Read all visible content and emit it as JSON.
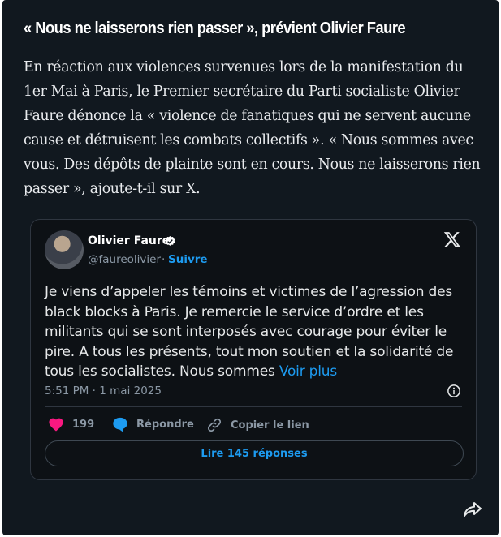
{
  "article": {
    "headline": "« Nous ne laisserons rien passer », prévient Olivier Faure",
    "body": "En réaction aux violences survenues lors de la manifestation du 1er Mai à Paris, le Premier secrétaire du Parti socialiste Olivier Faure dénonce la « violence de fanatiques qui ne servent aucune cause et détruisent les combats collectifs ». « Nous sommes avec vous. Des dépôts de plainte sont en cours. Nous ne laisserons rien passer », ajoute-t-il sur X."
  },
  "tweet": {
    "author_name": "Olivier Faure",
    "handle": "@faureolivier",
    "separator": "·",
    "follow_label": "Suivre",
    "text": "Je viens d’appeler les témoins et victimes de l’agression des black blocks à Paris. Je remercie le service d’ordre et les militants qui se sont interposés avec courage pour éviter le pire. A tous les présents, tout mon soutien et la solidarité de tous les socialistes. Nous sommes",
    "see_more_label": "Voir plus",
    "timestamp": "5:51 PM · 1 mai 2025",
    "likes": "199",
    "reply_label": "Répondre",
    "copy_link_label": "Copier le lien",
    "read_replies_label": "Lire 145 réponses"
  },
  "icons": {
    "verified": "verified-badge-icon",
    "x_logo": "x-logo-icon",
    "info": "info-icon",
    "like": "heart-icon",
    "reply": "speech-bubble-icon",
    "copy_link": "link-icon",
    "share": "share-icon"
  },
  "colors": {
    "card_background": "#11181f",
    "tweet_background": "#0d1115",
    "accent": "#1d9bf0",
    "like": "#f91880",
    "muted": "#8b98a5"
  }
}
